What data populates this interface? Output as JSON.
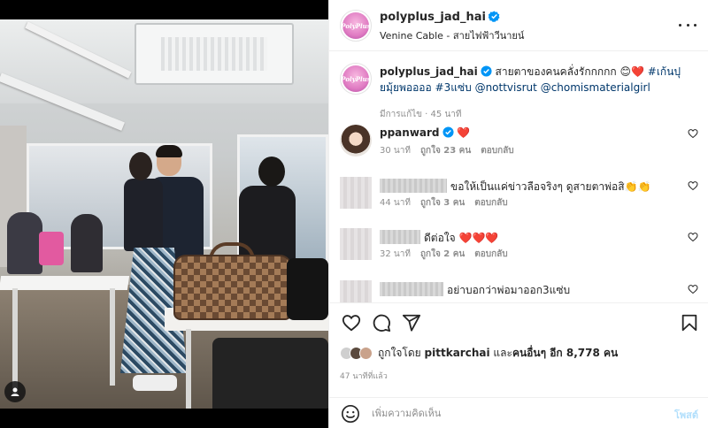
{
  "header": {
    "username": "polyplus_jad_hai",
    "location": "Venine Cable - สายไฟฟ้าวีนายน์",
    "brand_avatar_text": "PolyPlus"
  },
  "caption": {
    "username": "polyplus_jad_hai",
    "text": " สายตาของคนคลั่งรักกกกก 😊❤️",
    "hashtag": "#เก้นปุยมุ้ยพออออ",
    "hashtag2": "#3แซ่บ",
    "mention1": "@nottvisrut",
    "mention2": "@chomismaterialgirl",
    "meta": "มีการแก้ไข · 45 นาที"
  },
  "comments": [
    {
      "username": "ppanward",
      "text": "❤️",
      "time": "30 นาที",
      "likes": "ถูกใจ 23 คน",
      "reply": "ตอบกลับ"
    },
    {
      "username": "",
      "text": "ขอให้เป็นแค่ข่าวลือจริงๆ ดูสายตาพ่อสิ👏👏",
      "time": "44 นาที",
      "likes": "ถูกใจ 3 คน",
      "reply": "ตอบกลับ"
    },
    {
      "username": "",
      "text": "ดีต่อใจ ❤️❤️❤️",
      "time": "32 นาที",
      "likes": "ถูกใจ 2 คน",
      "reply": "ตอบกลับ"
    },
    {
      "username": "",
      "text": "อย่าบอกว่าพ่อมาออก3แซ่บ",
      "time": "",
      "likes": "",
      "reply": ""
    }
  ],
  "likes": {
    "prefix": "ถูกใจโดย",
    "user": "pittkarchai",
    "middle": "และ",
    "others": "คนอื่นๆ อีก 8,778 คน"
  },
  "time_ago": "47 นาทีที่แล้ว",
  "add_comment": {
    "placeholder": "เพิ่มความคิดเห็น",
    "post_label": "โพสต์"
  },
  "colors": {
    "verified": "#0095f6",
    "heart_red": "#ed4956",
    "post_disabled": "#b2dffc",
    "link": "#00376b"
  },
  "icons": [
    "more-icon",
    "verified-icon",
    "heart-icon",
    "comment-icon",
    "share-icon",
    "bookmark-icon",
    "emoji-icon",
    "user-tag-icon"
  ]
}
